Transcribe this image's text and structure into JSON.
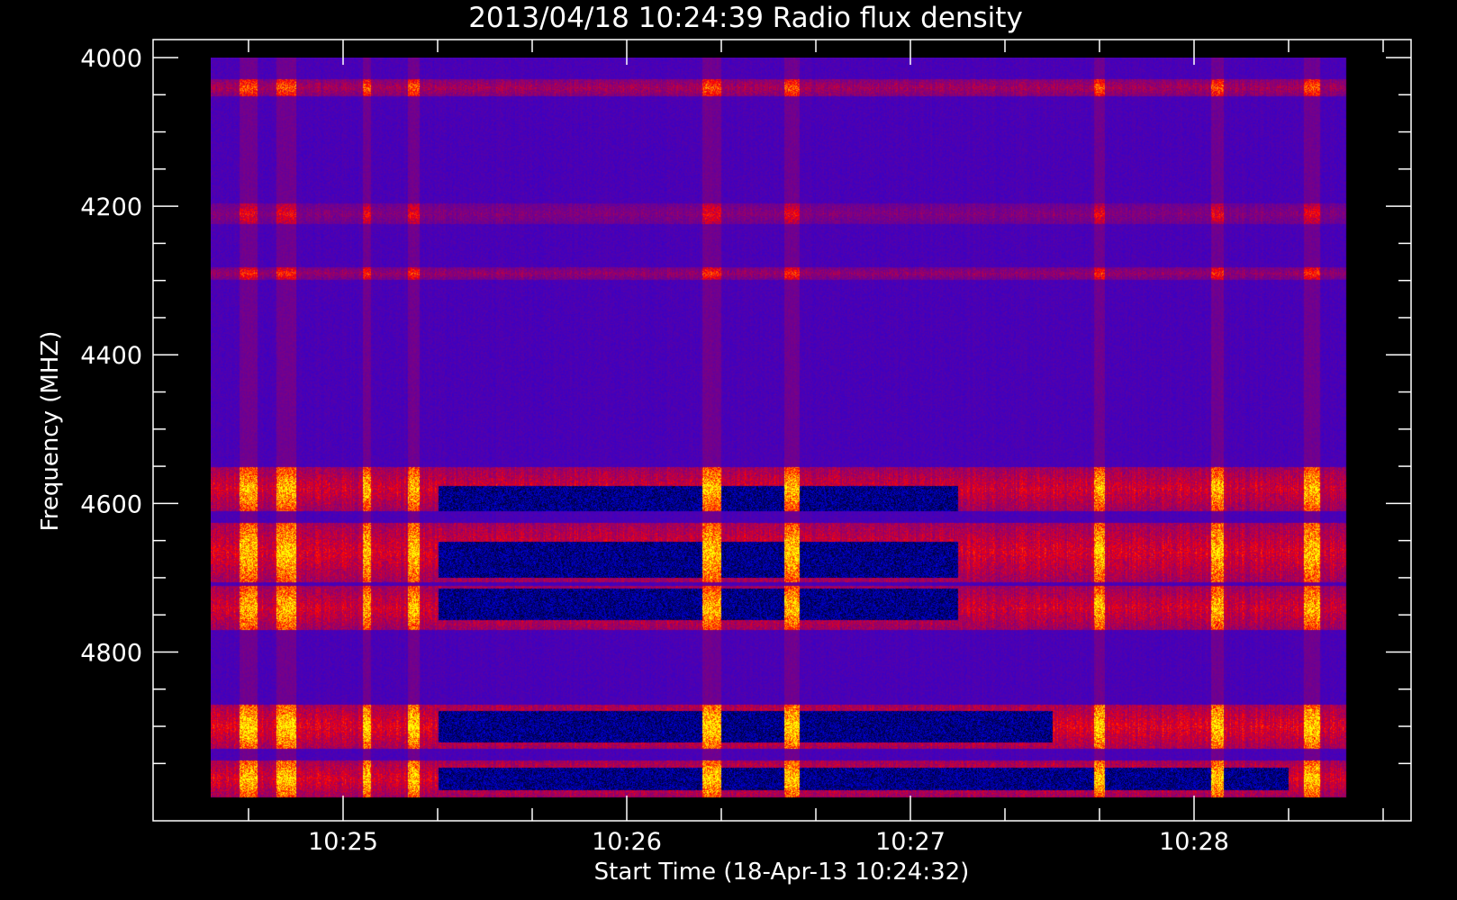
{
  "chart_data": {
    "type": "heatmap",
    "title": "2013/04/18 10:24:39 Radio flux density",
    "xlabel": "Start Time (18-Apr-13 10:24:32)",
    "ylabel": "Frequency (MHZ)",
    "x_unit": "time of day (minutes)",
    "xlim": [
      "10:24:32",
      "10:28:40"
    ],
    "ylim": [
      4000,
      5000
    ],
    "y_inverted": true,
    "x_major_ticks": [
      "10:25",
      "10:26",
      "10:27",
      "10:28"
    ],
    "x_minor_ticks": [
      "10:24:40",
      "10:25:20",
      "10:25:40",
      "10:26:20",
      "10:26:40",
      "10:27:20",
      "10:27:40",
      "10:28:20",
      "10:28:40"
    ],
    "y_major_ticks": [
      4000,
      4200,
      4400,
      4600,
      4800
    ],
    "y_minor_ticks": [
      4050,
      4100,
      4150,
      4250,
      4300,
      4350,
      4450,
      4500,
      4550,
      4650,
      4700,
      4750,
      4850,
      4900,
      4950
    ],
    "data_x_range": [
      "10:24:32",
      "10:28:32"
    ],
    "data_y_range": [
      4000,
      4995
    ],
    "colormap": [
      "#000000",
      "#0000ff",
      "#ff0000",
      "#ffff00"
    ],
    "background_level": "blue",
    "emission_bands_mhz": [
      {
        "center": 4040,
        "width": 12,
        "intensity": 0.55
      },
      {
        "center": 4210,
        "width": 14,
        "intensity": 0.35
      },
      {
        "center": 4290,
        "width": 8,
        "intensity": 0.45
      },
      {
        "center": 4580,
        "width": 30,
        "intensity": 0.8
      },
      {
        "center": 4665,
        "width": 40,
        "intensity": 0.85
      },
      {
        "center": 4740,
        "width": 30,
        "intensity": 0.8
      },
      {
        "center": 4900,
        "width": 30,
        "intensity": 0.9
      },
      {
        "center": 4970,
        "width": 25,
        "intensity": 0.85
      }
    ],
    "absorption_bands_mhz": [
      {
        "center": 4600,
        "width": 40,
        "x_from": "10:25:20",
        "x_to": "10:27:10"
      },
      {
        "center": 4675,
        "width": 40,
        "x_from": "10:25:20",
        "x_to": "10:27:10"
      },
      {
        "center": 4735,
        "width": 35,
        "x_from": "10:25:20",
        "x_to": "10:27:10"
      },
      {
        "center": 4900,
        "width": 35,
        "x_from": "10:25:20",
        "x_to": "10:27:30"
      },
      {
        "center": 4970,
        "width": 25,
        "x_from": "10:25:20",
        "x_to": "10:28:20"
      }
    ],
    "bright_time_columns": [
      "10:24:40",
      "10:24:48",
      "10:25:05",
      "10:25:15",
      "10:26:18",
      "10:26:35",
      "10:27:40",
      "10:28:05",
      "10:28:25"
    ],
    "grid": false,
    "legend": "none"
  }
}
